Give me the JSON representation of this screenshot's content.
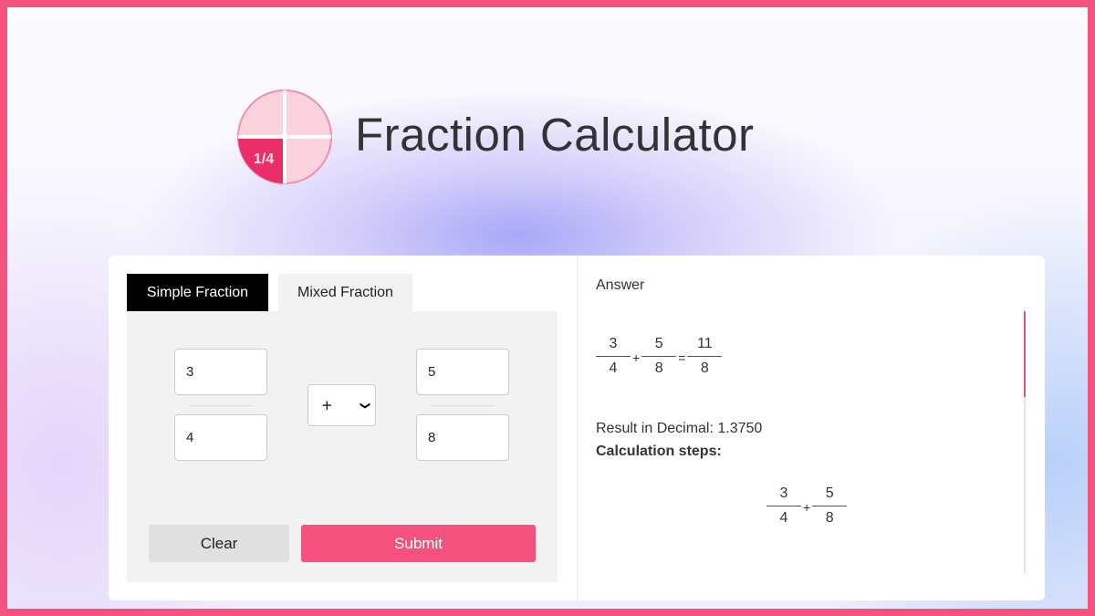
{
  "header": {
    "title": "Fraction Calculator",
    "logo_text": "1/4",
    "logo_icon": "quarter-pie-icon"
  },
  "colors": {
    "accent": "#f4517f",
    "tab_active": "#000000"
  },
  "tabs": [
    {
      "label": "Simple Fraction",
      "active": true
    },
    {
      "label": "Mixed Fraction",
      "active": false
    }
  ],
  "inputs": {
    "num1": "3",
    "den1": "4",
    "operator": "+",
    "num2": "5",
    "den2": "8"
  },
  "buttons": {
    "clear": "Clear",
    "submit": "Submit"
  },
  "answer": {
    "label": "Answer",
    "result": {
      "n1": "3",
      "d1": "4",
      "op": "+",
      "n2": "5",
      "d2": "8",
      "eq": "=",
      "rn": "11",
      "rd": "8"
    },
    "decimal": "Result in Decimal: 1.3750",
    "steps_label": "Calculation steps:",
    "step1": {
      "n1": "3",
      "d1": "4",
      "op": "+",
      "n2": "5",
      "d2": "8"
    }
  }
}
